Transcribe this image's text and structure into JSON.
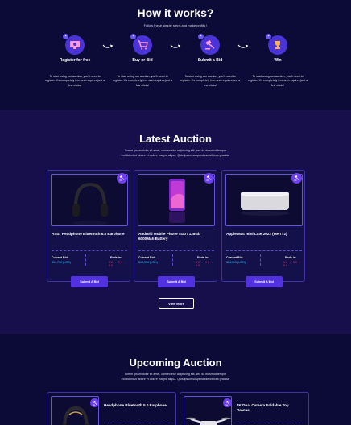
{
  "how_it_works": {
    "title": "How it works?",
    "subtitle": "Follow these simple steps and make profits !",
    "steps": [
      {
        "title": "Register for free",
        "desc": "To start using our auction, you'll need to register. It's completely free and requires just a few clicks!"
      },
      {
        "title": "Buy or Bid",
        "desc": "To start using our auction, you'll need to register. It's completely free and requires just a few clicks!"
      },
      {
        "title": "Submit a Bid",
        "desc": "To start using our auction, you'll need to register. It's completely free and requires just a few clicks!"
      },
      {
        "title": "Win",
        "desc": "To start using our auction, you'll need to register. It's completely free and requires just a few clicks!"
      }
    ]
  },
  "latest": {
    "title": "Latest Auction",
    "subtitle_line1": "Lorem ipsum dolor sit amet, consectetur adipiscing elit, sed do eiusmod tempor",
    "subtitle_line2": "incididunt ut labore et dolore magna aliqua. Quis ipsum suspendisse ultrices gravida.",
    "cards": [
      {
        "name": "AS47 Headphone Bluetooth 5.0 Earphone",
        "bid_label": "Current Bid:",
        "bid_value": "$14,750 (USD)",
        "ends_label": "Ends in:",
        "ends_value": "00 : 00 : 00",
        "button": "Submit A Bid",
        "image": "headphones"
      },
      {
        "name": "Android Mobile Phone 4Gb / 128Gb 6000Mah Battery",
        "bid_label": "Current Bid:",
        "bid_value": "$18,950 (USD)",
        "ends_label": "Ends in:",
        "ends_value": "00 : 00 : 00",
        "button": "Submit A Bid",
        "image": "smartphone"
      },
      {
        "name": "Apple Mac mini Late 2022 (MRTT2)",
        "bid_label": "Current Bid:",
        "bid_value": "$24,500 (USD)",
        "ends_label": "Ends in:",
        "ends_value": "00 : 00 : 00",
        "button": "Submit A Bid",
        "image": "mac-mini"
      }
    ],
    "view_more": "View More"
  },
  "upcoming": {
    "title": "Upcoming Auction",
    "subtitle_line1": "Lorem ipsum dolor sit amet, consectetur adipiscing elit, sed do eiusmod tempor",
    "subtitle_line2": "incididunt ut labore et dolore magna aliqua. Quis ipsum suspendisse ultrices gravida.",
    "cards": [
      {
        "name": "Headphone Bluetooth 5.0 Earphone",
        "image": "headphones"
      },
      {
        "name": "4K Dual Camera Foldable Toy Drones",
        "image": "drone"
      }
    ]
  },
  "colors": {
    "bg": "#0c0a36",
    "section_bg": "#160f4b",
    "accent": "#5232e0",
    "bid": "#23c7ff",
    "timer": "#e23c6a"
  }
}
